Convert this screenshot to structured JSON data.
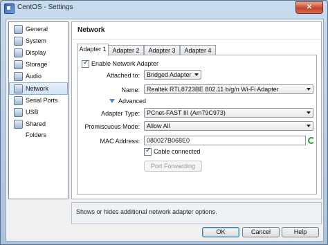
{
  "window": {
    "title": "CentOS - Settings",
    "close_glyph": "✕"
  },
  "sidebar": {
    "items": [
      {
        "label": "General",
        "icon": "general-icon"
      },
      {
        "label": "System",
        "icon": "system-icon"
      },
      {
        "label": "Display",
        "icon": "display-icon"
      },
      {
        "label": "Storage",
        "icon": "storage-icon"
      },
      {
        "label": "Audio",
        "icon": "audio-icon"
      },
      {
        "label": "Network",
        "icon": "network-icon",
        "selected": true
      },
      {
        "label": "Serial Ports",
        "icon": "serial-ports-icon"
      },
      {
        "label": "USB",
        "icon": "usb-icon"
      },
      {
        "label": "Shared Folders",
        "icon": "shared-folders-icon"
      }
    ]
  },
  "network": {
    "title": "Network",
    "tabs": [
      "Adapter 1",
      "Adapter 2",
      "Adapter 3",
      "Adapter 4"
    ],
    "enable_label": "Enable Network Adapter",
    "attached_label": "Attached to:",
    "attached_value": "Bridged Adapter",
    "name_label": "Name:",
    "name_value": "Realtek RTL8723BE 802.11 b/g/n Wi-Fi Adapter",
    "advanced_label": "Advanced",
    "adapter_type_label": "Adapter Type:",
    "adapter_type_value": "PCnet-FAST III (Am79C973)",
    "promiscuous_label": "Promiscuous Mode:",
    "promiscuous_value": "Allow All",
    "mac_label": "MAC Address:",
    "mac_value": "080027B068E0",
    "cable_label": "Cable connected",
    "port_forwarding_label": "Port Forwarding"
  },
  "help": {
    "text": "Shows or hides additional network adapter options."
  },
  "footer": {
    "ok": "OK",
    "cancel": "Cancel",
    "help": "Help"
  },
  "checks": {
    "glyph": "✓"
  }
}
